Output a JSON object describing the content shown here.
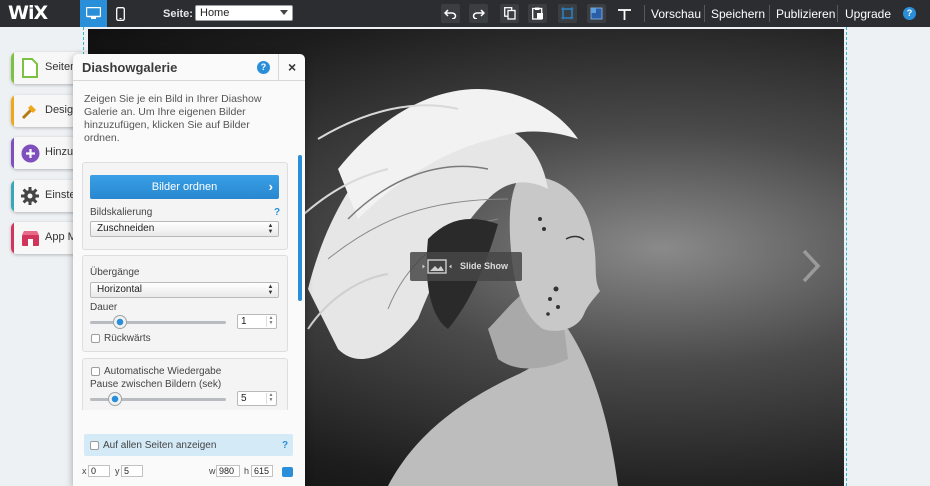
{
  "topbar": {
    "logo": "WiX",
    "page_label": "Seite:",
    "page_select_value": "Home",
    "preview_label": "Vorschau",
    "save_label": "Speichern",
    "publish_label": "Publizieren",
    "upgrade_label": "Upgrade",
    "help_glyph": "?"
  },
  "rail": {
    "items": [
      {
        "label": "Seiten",
        "icon": "pages-icon",
        "color": "#7cc242"
      },
      {
        "label": "Design",
        "icon": "brush-icon",
        "color": "#f0a818"
      },
      {
        "label": "Hinzufügen",
        "icon": "plus-circle-icon",
        "color": "#7e4fbd"
      },
      {
        "label": "Einstellungen",
        "icon": "gear-icon",
        "color": "#37a8b8"
      },
      {
        "label": "App Market",
        "icon": "app-market-icon",
        "color": "#d1355c"
      }
    ]
  },
  "canvas": {
    "slideshow_label": "Slide Show"
  },
  "panel": {
    "title": "Diashowgalerie",
    "help_glyph": "?",
    "close_glyph": "×",
    "description": "Zeigen Sie je ein Bild in Ihrer Diashow Galerie an. Um Ihre eigenen Bilder hinzuzufügen, klicken Sie auf Bilder ordnen.",
    "organize_button": "Bilder ordnen",
    "scaling_label": "Bildskalierung",
    "scaling_help": "?",
    "scaling_value": "Zuschneiden",
    "transitions_label": "Übergänge",
    "transitions_value": "Horizontal",
    "duration_label": "Dauer",
    "duration_value": "1",
    "backwards_label": "Rückwärts",
    "autoplay_label": "Automatische Wiedergabe",
    "pause_label": "Pause zwischen Bildern (sek)",
    "pause_value": "5",
    "all_pages_label": "Auf allen Seiten anzeigen",
    "all_pages_help": "?",
    "x_label": "x",
    "x_value": "0",
    "y_label": "y",
    "y_value": "5",
    "w_label": "w",
    "w_value": "980",
    "h_label": "h",
    "h_value": "615"
  }
}
